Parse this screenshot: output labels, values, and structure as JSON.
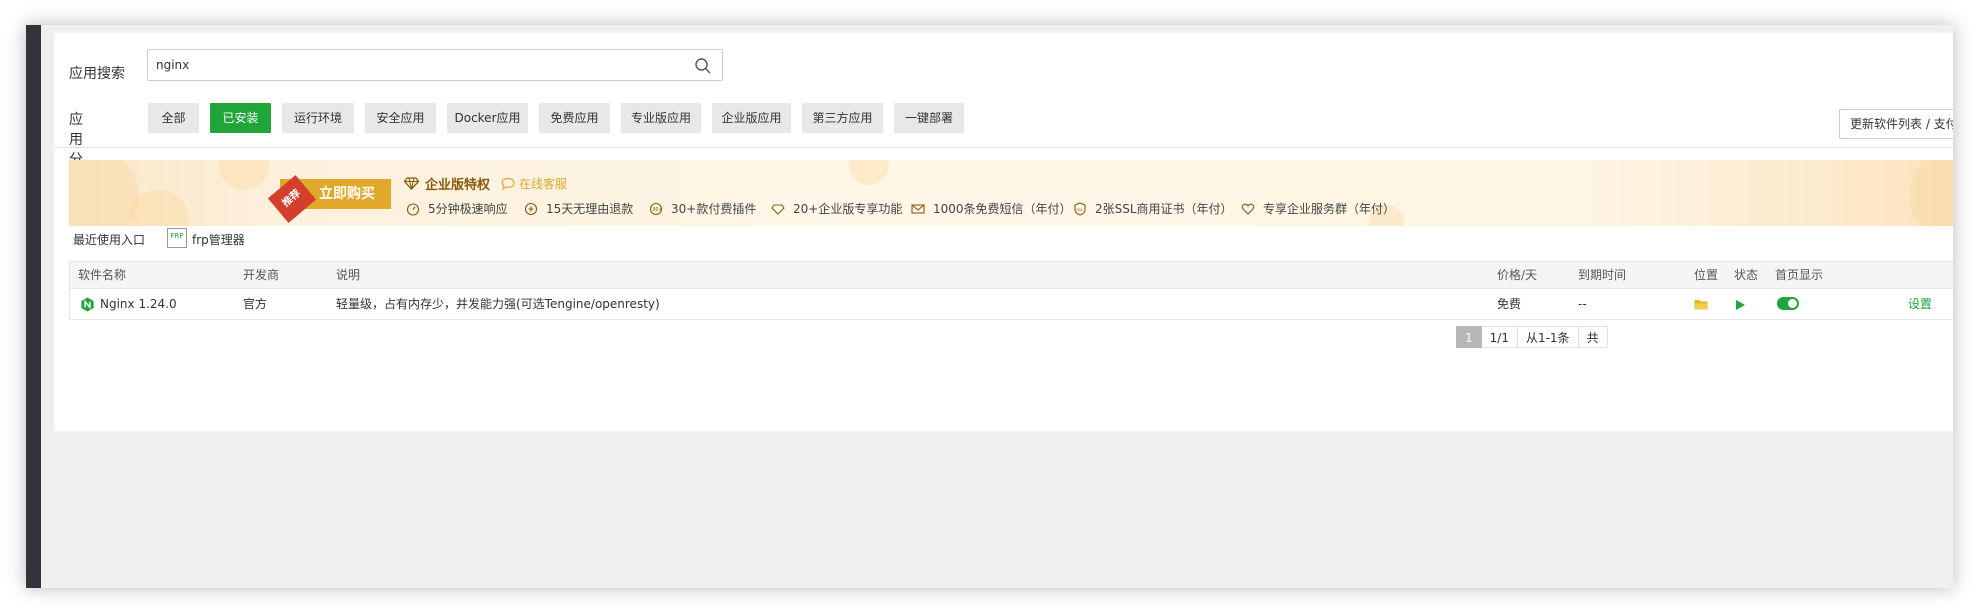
{
  "search": {
    "label": "应用搜索",
    "value": "nginx"
  },
  "categories": {
    "label": "应用分类",
    "items": [
      "全部",
      "已安装",
      "运行环境",
      "安全应用",
      "Docker应用",
      "免费应用",
      "专业版应用",
      "企业版应用",
      "第三方应用",
      "一键部署"
    ],
    "active": "已安装"
  },
  "update_button": "更新软件列表 / 支付",
  "banner": {
    "ribbon": "推荐",
    "buy": "立即购买",
    "title": "企业版特权",
    "online": "在线客服",
    "features": [
      "5分钟极速响应",
      "15天无理由退款",
      "30+款付费插件",
      "20+企业版专享功能",
      "1000条免费短信（年付）",
      "2张SSL商用证书（年付）",
      "专享企业服务群（年付）"
    ]
  },
  "recent": {
    "label": "最近使用入口",
    "frp_icon": "FRP",
    "frp_label": "frp管理器"
  },
  "table": {
    "headers": {
      "name": "软件名称",
      "developer": "开发商",
      "desc": "说明",
      "price": "价格/天",
      "expire": "到期时间",
      "location": "位置",
      "status": "状态",
      "home": "首页显示"
    },
    "rows": [
      {
        "name": "Nginx 1.24.0",
        "developer": "官方",
        "desc": "轻量级，占有内存少，并发能力强(可选Tengine/openresty)",
        "price": "免费",
        "expire": "--",
        "action": "设置",
        "home_enabled": true
      }
    ]
  },
  "pager": {
    "current": "1",
    "total": "1/1",
    "range": "从1-1条",
    "more": "共"
  },
  "colors": {
    "accent": "#20a53a",
    "gold": "#e2a82a",
    "sidebar": "#2f353b"
  }
}
